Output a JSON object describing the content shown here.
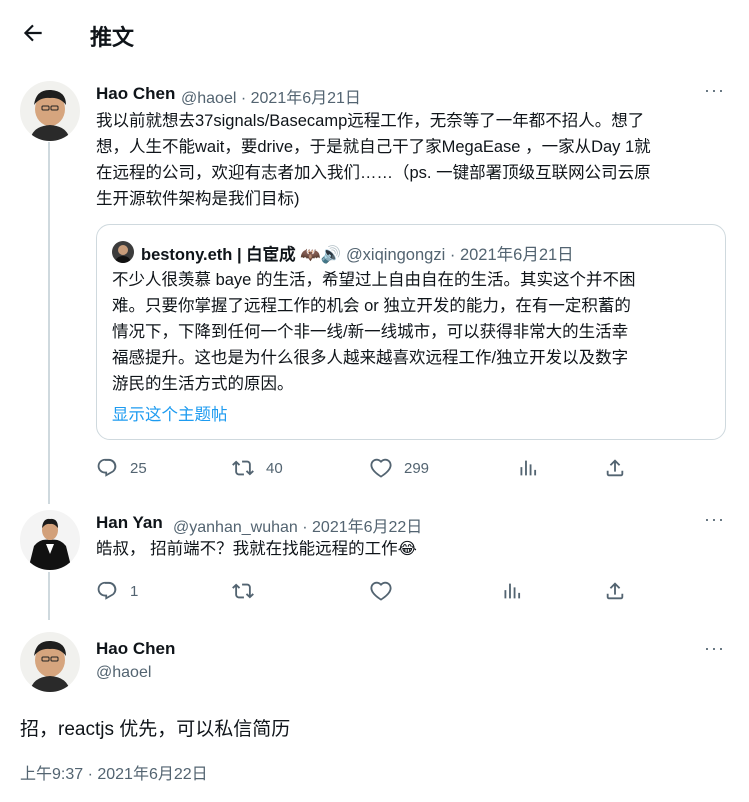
{
  "header": {
    "title": "推文"
  },
  "tweet1": {
    "name": "Hao Chen",
    "handle": "@haoel",
    "sep": "·",
    "date": "2021年6月21日",
    "more": "···",
    "text_lines": [
      "我以前就想去37signals/Basecamp远程工作，无奈等了一年都不招人。想了",
      "想，人生不能wait，要drive，于是就自己干了家MegaEase ，一家从Day 1就",
      "在远程的公司，欢迎有志者加入我们……（ps. 一键部署顶级互联网公司云原",
      "生开源软件架构是我们目标)"
    ],
    "quote": {
      "name": "bestony.eth | 白宦成",
      "emoji": "🦇🔊",
      "handle": "@xiqingongzi",
      "sep": "·",
      "date": "2021年6月21日",
      "text_lines": [
        "不少人很羡慕 baye 的生活，希望过上自由自在的生活。其实这个并不困",
        "难。只要你掌握了远程工作的机会 or 独立开发的能力，在有一定积蓄的",
        "情况下，下降到任何一个非一线/新一线城市，可以获得非常大的生活幸",
        "福感提升。这也是为什么很多人越来越喜欢远程工作/独立开发以及数字",
        "游民的生活方式的原因。"
      ],
      "show_thread": "显示这个主题帖"
    },
    "replies": "25",
    "retweets": "40",
    "likes": "299"
  },
  "tweet2": {
    "name": "Han Yan",
    "handle": "@yanhan_wuhan",
    "sep": "·",
    "date": "2021年6月22日",
    "more": "···",
    "text": "皓叔， 招前端不？我就在找能远程的工作😂",
    "replies": "1"
  },
  "main_tweet": {
    "name": "Hao Chen",
    "handle": "@haoel",
    "more": "···",
    "text": "招，reactjs 优先，可以私信简历",
    "timestamp": "上午9:37 · 2021年6月22日"
  },
  "colors": {
    "accent": "#1d9bf0",
    "muted": "#536471",
    "line": "#cfd9de"
  },
  "icons": [
    "back-arrow-icon",
    "reply-icon",
    "retweet-icon",
    "like-icon",
    "analytics-icon",
    "share-icon",
    "more-icon"
  ]
}
